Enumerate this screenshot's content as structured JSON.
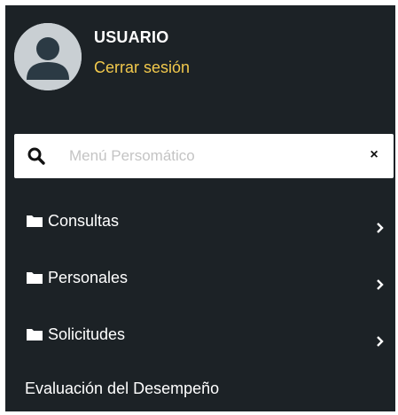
{
  "user": {
    "name": "USUARIO",
    "logout_label": "Cerrar sesión",
    "avatar_icon": "user-avatar-icon"
  },
  "search": {
    "placeholder": "Menú Persomático",
    "value": "",
    "search_icon": "search-icon",
    "clear_icon": "close-icon",
    "clear_glyph": "×"
  },
  "menu": {
    "items": [
      {
        "label": "Consultas",
        "icon": "folder-icon",
        "has_submenu": true
      },
      {
        "label": "Personales",
        "icon": "folder-icon",
        "has_submenu": true
      },
      {
        "label": "Solicitudes",
        "icon": "folder-icon",
        "has_submenu": true
      },
      {
        "label": "Evaluación del Desempeño",
        "icon": "",
        "has_submenu": false
      }
    ]
  },
  "colors": {
    "sidebar_background": "#1c2226",
    "text": "#ffffff",
    "logout_link": "#f2c94c",
    "avatar_background": "#c9cfd3"
  }
}
